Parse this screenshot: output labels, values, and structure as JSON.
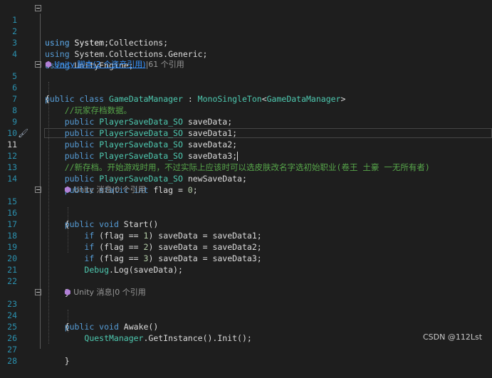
{
  "editor": {
    "line_numbers": [
      "1",
      "2",
      "3",
      "4",
      "5",
      "6",
      "7",
      "8",
      "9",
      "10",
      "11",
      "12",
      "13",
      "14",
      "15",
      "16",
      "17",
      "18",
      "19",
      "20",
      "21",
      "22",
      "23",
      "24",
      "25",
      "26",
      "27",
      "28"
    ],
    "active_line": "11",
    "code_lens": {
      "class": {
        "link": "Unity 脚本(2 个资产引用)",
        "rest": "|61 个引用"
      },
      "start": "Unity 消息|0 个引用",
      "awake": "Unity 消息|0 个引用"
    },
    "comments": {
      "save_data": "//玩家存档数据。",
      "new_save": "//新存档。开始游戏时用，不过实际上应该时可以选皮肤改名字选初始职业(卷王 土豪 一无所有者)"
    },
    "numbers": {
      "zero": "0",
      "one": "1",
      "two": "2",
      "three": "3"
    }
  },
  "watermark": "CSDN @112Lst"
}
